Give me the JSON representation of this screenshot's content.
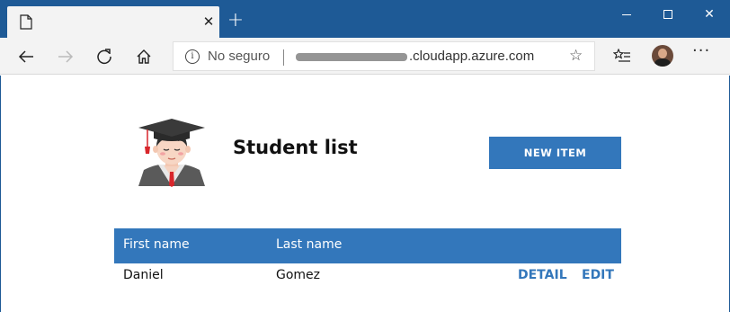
{
  "window": {
    "new_tab_glyph": "+",
    "close_tab_glyph": "✕",
    "close_window_glyph": "✕",
    "title_bar_color": "#1e5a96"
  },
  "toolbar": {
    "back_icon": "back-arrow-icon",
    "forward_icon": "forward-arrow-icon",
    "refresh_icon": "refresh-icon",
    "home_icon": "home-icon",
    "security_label": "No seguro",
    "url_visible": ".cloudapp.azure.com",
    "favorite_glyph": "☆",
    "menu_glyph": "···"
  },
  "page": {
    "title": "Student list",
    "new_item_label": "NEW ITEM",
    "accent_color": "#3377bb",
    "table": {
      "columns": [
        "First name",
        "Last name"
      ],
      "rows": [
        {
          "first_name": "Daniel",
          "last_name": "Gomez",
          "detail_label": "DETAIL",
          "edit_label": "EDIT"
        }
      ]
    }
  }
}
